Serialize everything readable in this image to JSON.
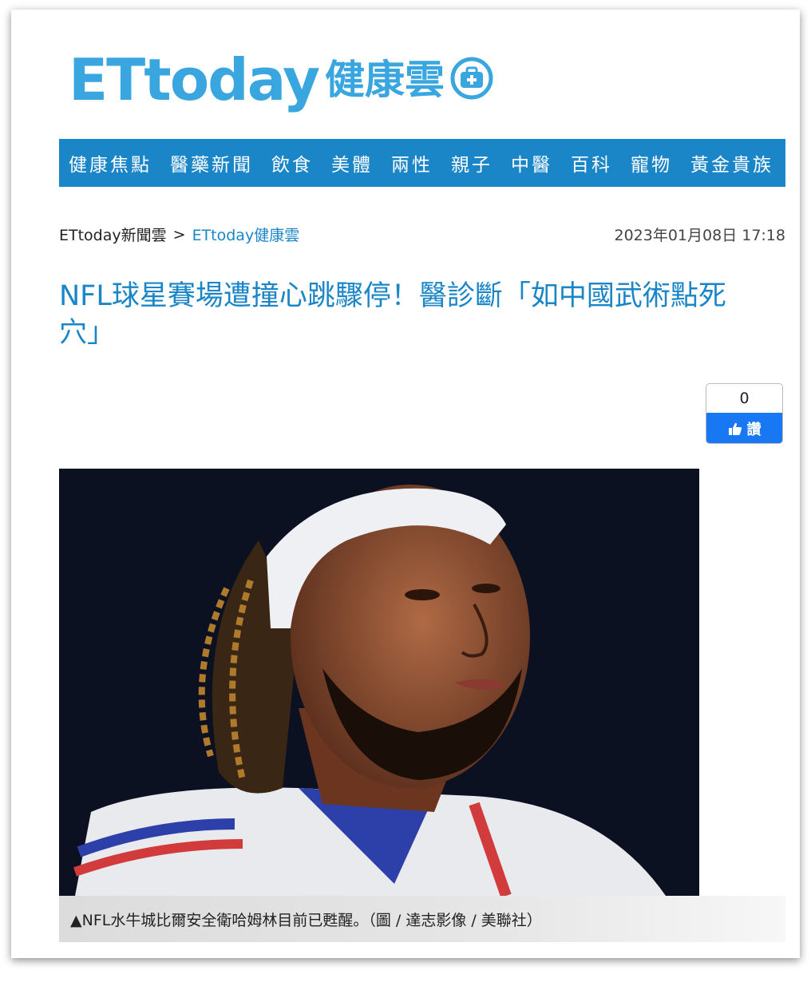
{
  "site": {
    "logo_text": "ETtoday",
    "logo_sub": "健康雲",
    "brand_color": "#3aa6df"
  },
  "nav": {
    "color": "#1a85c7",
    "items": [
      "健康焦點",
      "醫藥新聞",
      "飲食",
      "美體",
      "兩性",
      "親子",
      "中醫",
      "百科",
      "寵物",
      "黃金貴族"
    ]
  },
  "breadcrumb": {
    "home": "ETtoday新聞雲",
    "separator": ">",
    "section": "ETtoday健康雲"
  },
  "article": {
    "date": "2023年01月08日 17:18",
    "title": "NFL球星賽場遭撞心跳驟停！醫診斷「如中國武術點死穴」",
    "image_caption": "▲NFL水牛城比爾安全衛哈姆林目前已甦醒。（圖 / 達志影像 / 美聯社）"
  },
  "like_widget": {
    "count": "0",
    "label": "讚",
    "icon": "thumbs-up-icon",
    "color": "#1877f2"
  }
}
